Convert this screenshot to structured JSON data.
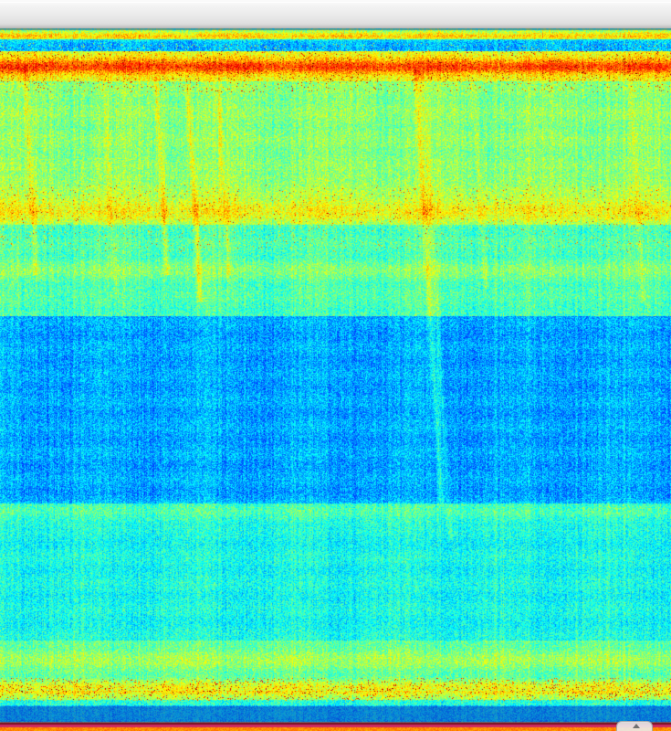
{
  "window": {
    "title": ""
  },
  "spectrogram": {
    "colormap": "jet",
    "colors": {
      "background_blue": "#1f74d3",
      "deep_blue": "#0b47b7",
      "cyan": "#24b9e8",
      "green": "#69d85c",
      "yellow": "#f3e245",
      "red": "#db2b19",
      "dark_red": "#7b1020"
    }
  },
  "icons": {
    "scroll_arrow": "scroll-up-arrow-icon"
  }
}
